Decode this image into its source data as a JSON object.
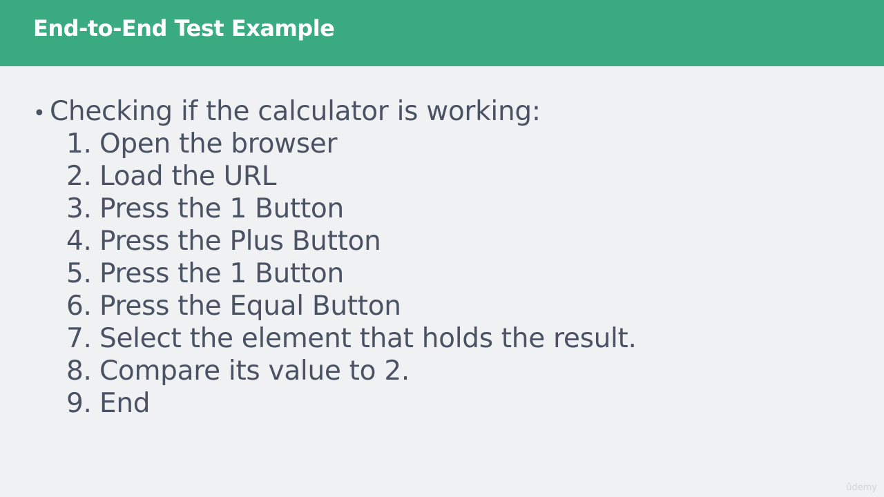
{
  "slide": {
    "title": "End-to-End Test Example",
    "bullet_text": "Checking if the calculator is working:",
    "steps": [
      {
        "number": "1.",
        "text": "Open the browser"
      },
      {
        "number": "2.",
        "text": "Load the URL"
      },
      {
        "number": "3.",
        "text": "Press the 1 Button"
      },
      {
        "number": "4.",
        "text": "Press the Plus Button"
      },
      {
        "number": "5.",
        "text": "Press the 1 Button"
      },
      {
        "number": "6.",
        "text": "Press the Equal Button"
      },
      {
        "number": "7.",
        "text": "Select the element that holds the result."
      },
      {
        "number": "8.",
        "text": "Compare its value to 2."
      },
      {
        "number": "9.",
        "text": "End"
      }
    ],
    "watermark": "ûdemy"
  },
  "colors": {
    "title_bar": "#3aaa80",
    "background": "#eff1f2",
    "text": "#4b5263",
    "title_text": "#ffffff"
  }
}
